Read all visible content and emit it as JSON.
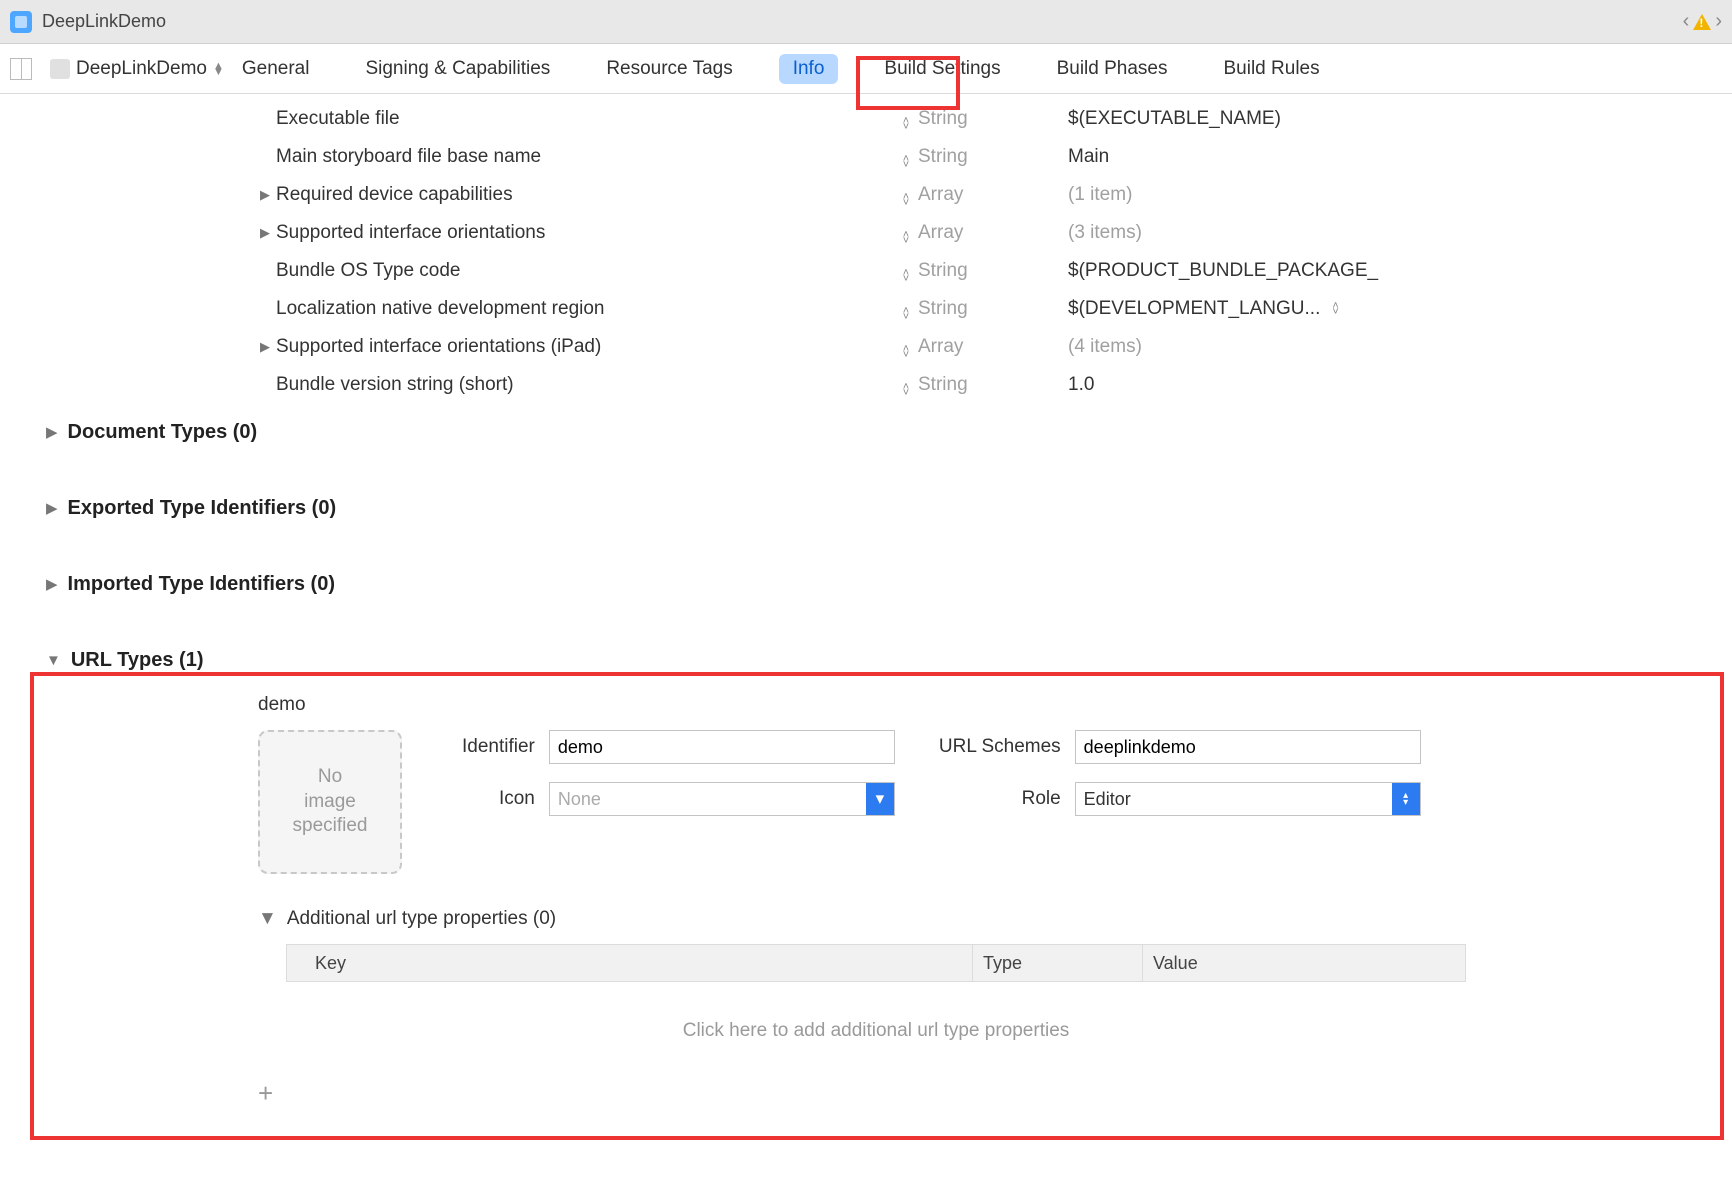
{
  "titlebar": {
    "project": "DeepLinkDemo"
  },
  "target_name": "DeepLinkDemo",
  "tabs": {
    "general": "General",
    "signing": "Signing & Capabilities",
    "resource": "Resource Tags",
    "info": "Info",
    "build_settings": "Build Settings",
    "build_phases": "Build Phases",
    "build_rules": "Build Rules"
  },
  "plist": [
    {
      "key": "Executable file",
      "type": "String",
      "value": "$(EXECUTABLE_NAME)",
      "expandable": false
    },
    {
      "key": "Main storyboard file base name",
      "type": "String",
      "value": "Main",
      "expandable": false
    },
    {
      "key": "Required device capabilities",
      "type": "Array",
      "value": "(1 item)",
      "expandable": true,
      "dim": true
    },
    {
      "key": "Supported interface orientations",
      "type": "Array",
      "value": "(3 items)",
      "expandable": true,
      "dim": true
    },
    {
      "key": "Bundle OS Type code",
      "type": "String",
      "value": "$(PRODUCT_BUNDLE_PACKAGE_",
      "expandable": false
    },
    {
      "key": "Localization native development region",
      "type": "String",
      "value": "$(DEVELOPMENT_LANGU...",
      "expandable": false,
      "stepper_right": true
    },
    {
      "key": "Supported interface orientations (iPad)",
      "type": "Array",
      "value": "(4 items)",
      "expandable": true,
      "dim": true
    },
    {
      "key": "Bundle version string (short)",
      "type": "String",
      "value": "1.0",
      "expandable": false
    }
  ],
  "sections": {
    "doc_types": "Document Types (0)",
    "exported": "Exported Type Identifiers (0)",
    "imported": "Imported Type Identifiers (0)",
    "url_types": "URL Types (1)"
  },
  "url_type": {
    "name": "demo",
    "no_image": "No image specified",
    "labels": {
      "identifier": "Identifier",
      "icon": "Icon",
      "url_schemes": "URL Schemes",
      "role": "Role"
    },
    "values": {
      "identifier": "demo",
      "icon": "None",
      "url_schemes": "deeplinkdemo",
      "role": "Editor"
    },
    "additional": "Additional url type properties (0)",
    "table": {
      "key": "Key",
      "type": "Type",
      "value": "Value"
    },
    "hint": "Click here to add additional url type properties"
  }
}
